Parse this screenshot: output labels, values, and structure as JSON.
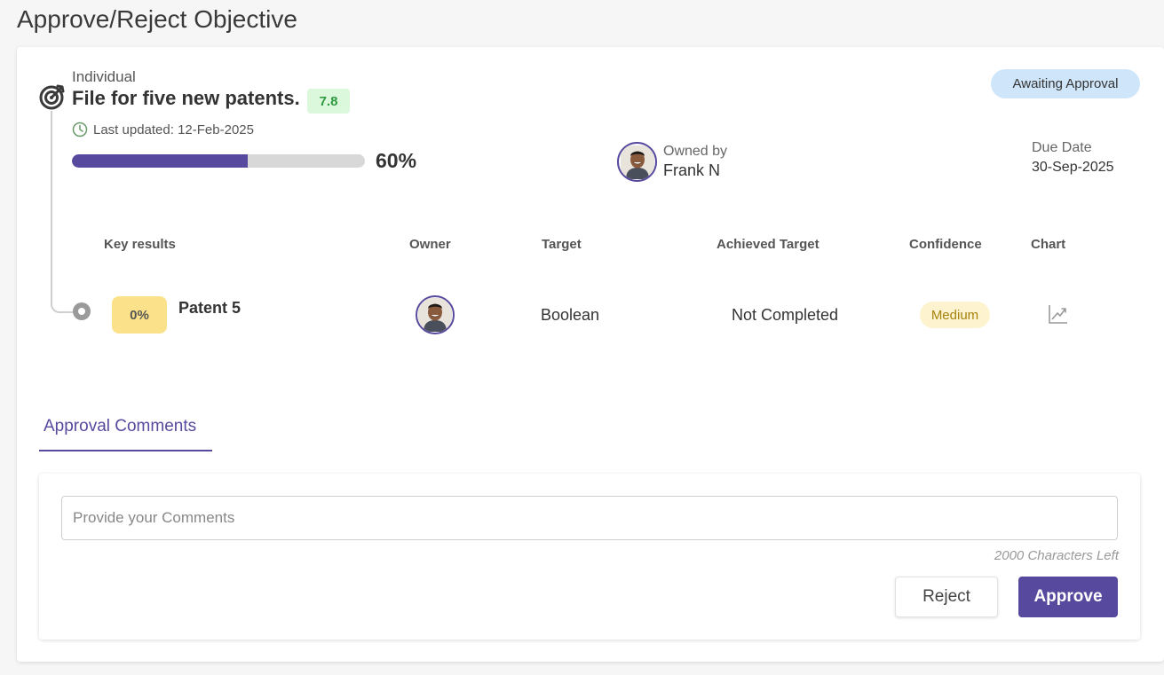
{
  "page": {
    "title": "Approve/Reject Objective"
  },
  "objective": {
    "type": "Individual",
    "title": "File for five new patents.",
    "score": "7.8",
    "last_updated": "Last updated: 12-Feb-2025",
    "progress_percent": 60,
    "progress_label": "60%",
    "status": "Awaiting Approval",
    "owner_label": "Owned by",
    "owner_name": "Frank N",
    "due_label": "Due Date",
    "due_date": "30-Sep-2025"
  },
  "key_results_table": {
    "headers": {
      "key_results": "Key results",
      "owner": "Owner",
      "target": "Target",
      "achieved_target": "Achieved Target",
      "confidence": "Confidence",
      "chart": "Chart"
    },
    "rows": [
      {
        "progress": "0%",
        "name": "Patent 5",
        "target": "Boolean",
        "achieved": "Not Completed",
        "confidence": "Medium"
      }
    ]
  },
  "comments": {
    "tab_label": "Approval Comments",
    "placeholder": "Provide your Comments",
    "value": "",
    "chars_left": "2000 Characters Left",
    "reject_label": "Reject",
    "approve_label": "Approve"
  },
  "colors": {
    "accent": "#574a9e",
    "progress_track": "#d8d8d8",
    "score_bg": "#dcf8dc",
    "score_text": "#2e9a3e",
    "status_bg": "#cfe6fa",
    "kr_progress_bg": "#fbe28a",
    "confidence_bg": "#fdf3cf",
    "confidence_text": "#a6830d"
  },
  "icons": {
    "objective": "target-icon",
    "last_updated": "clock-icon",
    "chart": "trend-chart-icon",
    "owner": "avatar"
  }
}
